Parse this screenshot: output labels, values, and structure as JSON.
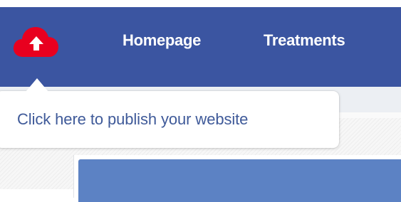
{
  "navbar": {
    "publish_icon": "cloud-upload-icon",
    "items": [
      {
        "label": "Homepage"
      },
      {
        "label": "Treatments"
      }
    ]
  },
  "tooltip": {
    "text": "Click here to publish your website"
  },
  "colors": {
    "navbar_bg": "#3b55a1",
    "publish_icon": "#e8001f",
    "nav_text": "#ffffff",
    "tooltip_text": "#3f5a99",
    "preview_header": "#5c82c4"
  }
}
